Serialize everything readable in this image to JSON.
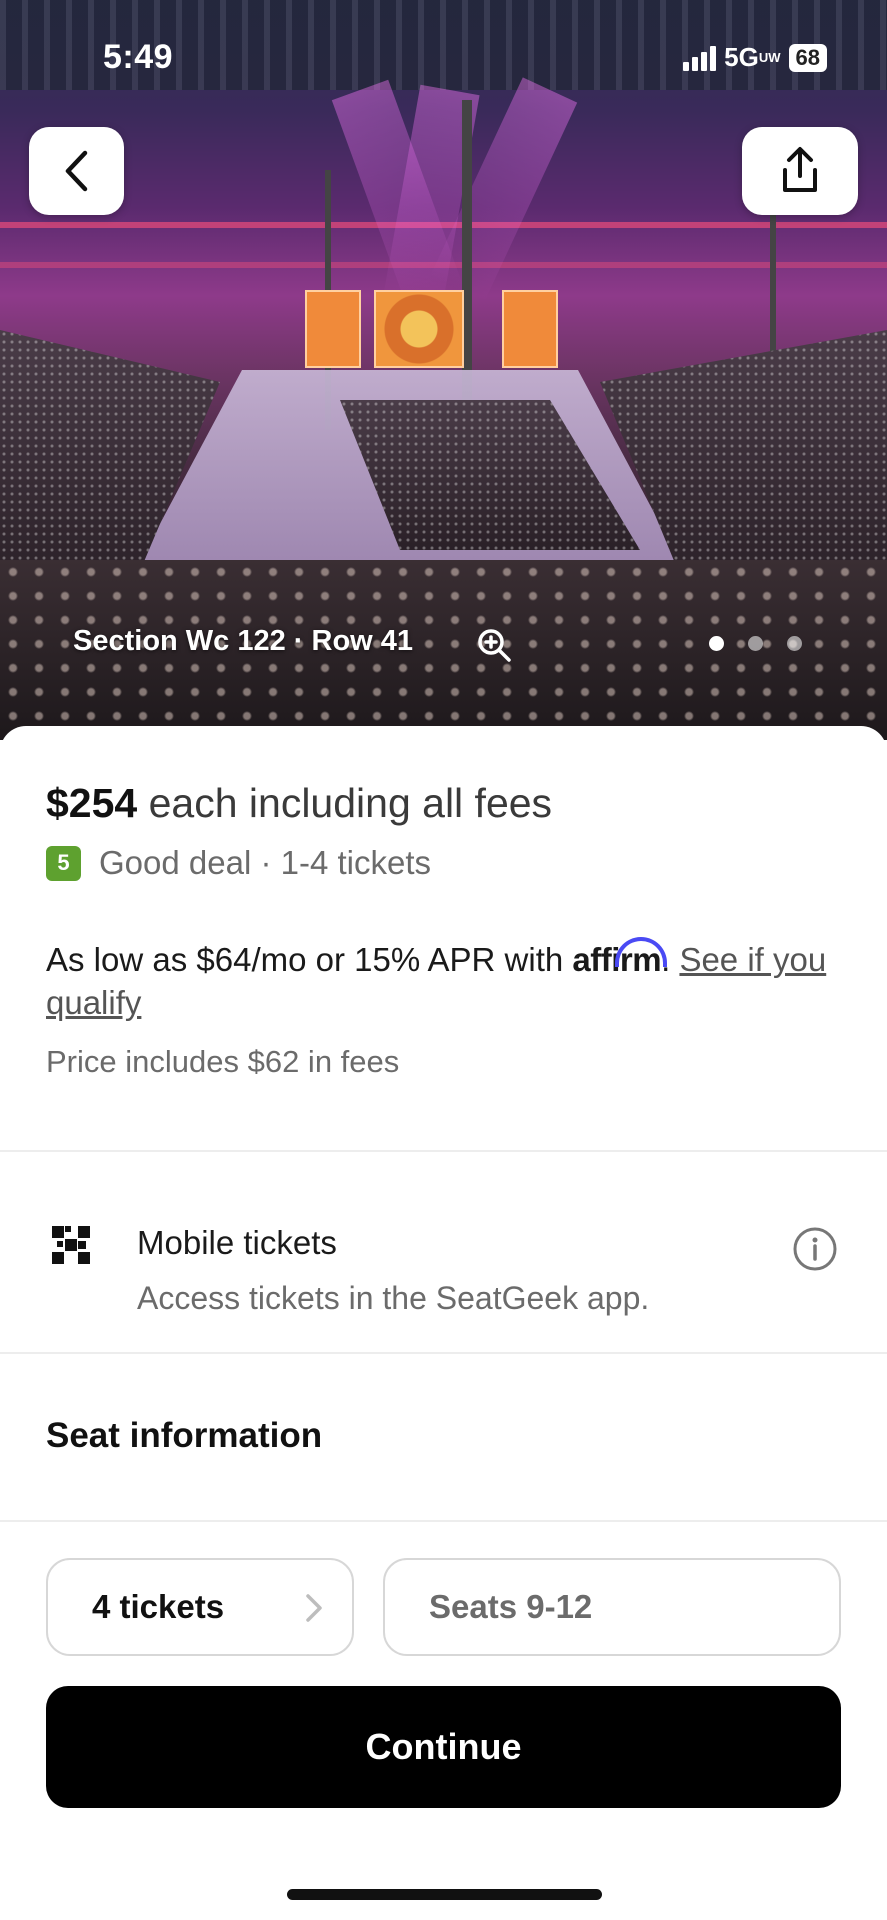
{
  "status_bar": {
    "time": "5:49",
    "network": "5G",
    "network_sub": "UW",
    "battery": "68",
    "icons": [
      "signal-bars-icon",
      "battery-icon"
    ]
  },
  "hero": {
    "section_label": "Section Wc 122 · Row 41",
    "image_count": 3,
    "active_image": 1,
    "icons": [
      "back-chevron-icon",
      "share-icon",
      "zoom-in-icon"
    ]
  },
  "pricing": {
    "amount": "$254",
    "suffix": " each including all fees",
    "deal_score": "5",
    "deal_text": "Good deal · 1-4 tickets",
    "deal_color": "#5ea12f"
  },
  "financing": {
    "prefix": "As low as $64/mo or 15% APR with ",
    "brand": "affirm",
    "period": ".",
    "link": "See if you qualify",
    "brand_color": "#4a4af4"
  },
  "fees_note": "Price includes $62 in fees",
  "delivery": {
    "title": "Mobile tickets",
    "subtitle": "Access tickets in the SeatGeek app.",
    "icons": [
      "qr-code-icon",
      "info-icon"
    ]
  },
  "seat_info_heading": "Seat information",
  "bottom": {
    "tickets_label": "4 tickets",
    "seats_label": "Seats 9-12",
    "continue_label": "Continue"
  }
}
